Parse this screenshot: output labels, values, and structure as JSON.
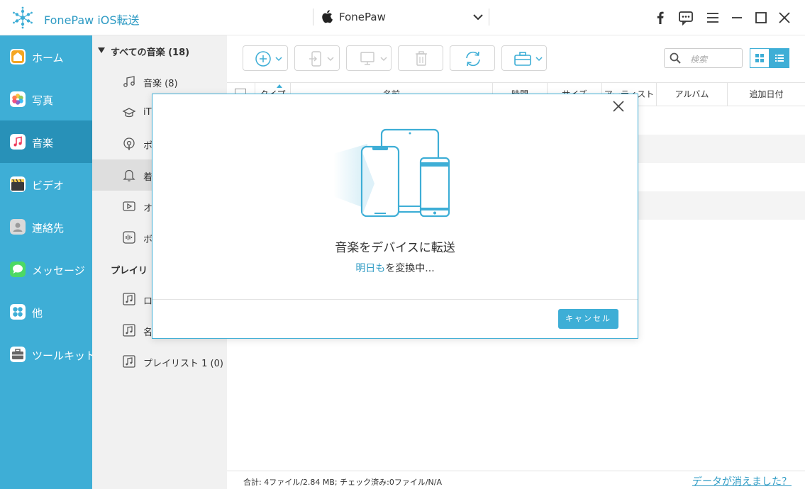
{
  "app": {
    "title": "FonePaw iOS転送"
  },
  "device": {
    "name": "FonePaw"
  },
  "sidebar": {
    "items": [
      {
        "label": "ホーム",
        "icon": "home-icon",
        "color": "#f5a623"
      },
      {
        "label": "写真",
        "icon": "photos-icon",
        "color": "#ffffff"
      },
      {
        "label": "音楽",
        "icon": "music-icon",
        "color": "#ffffff"
      },
      {
        "label": "ビデオ",
        "icon": "video-icon",
        "color": "#3a3a3a"
      },
      {
        "label": "連絡先",
        "icon": "contacts-icon",
        "color": "#9a9a9a"
      },
      {
        "label": "メッセージ",
        "icon": "messages-icon",
        "color": "#4cd964"
      },
      {
        "label": "他",
        "icon": "other-icon",
        "color": "#ffffff"
      },
      {
        "label": "ツールキット",
        "icon": "toolkit-icon",
        "color": "#666666"
      }
    ],
    "active": "音楽"
  },
  "subpanel": {
    "all_music_header": "すべての音楽 (18)",
    "items": [
      {
        "label": "音楽 (8)",
        "icon": "note-icon"
      },
      {
        "label": "iT",
        "icon": "itunes-u-icon"
      },
      {
        "label": "ポ",
        "icon": "podcast-icon"
      },
      {
        "label": "着",
        "icon": "bell-icon"
      },
      {
        "label": "オ",
        "icon": "audiobook-icon"
      },
      {
        "label": "ボ",
        "icon": "voice-memo-icon"
      }
    ],
    "playlist_header": "プレイリ",
    "playlists": [
      {
        "label": "ロ"
      },
      {
        "label": "名"
      },
      {
        "label": "プレイリスト 1 (0)"
      }
    ]
  },
  "toolbar": {
    "search_placeholder": "検索"
  },
  "table": {
    "columns": [
      "タイプ",
      "名前",
      "時間",
      "サイズ",
      "アーティスト",
      "アルバム",
      "追加日付"
    ]
  },
  "status": {
    "summary": "合計: 4ファイル/2.84 MB; チェック済み:0ファイル/N/A",
    "data_link": "データが消えました？"
  },
  "modal": {
    "title": "音楽をデバイスに転送",
    "item_name": "明日も",
    "progress_suffix": "を変換中...",
    "cancel_label": "キャンセル"
  },
  "colors": {
    "accent": "#3eaed6",
    "accent_dark": "#2891b8",
    "link": "#2f9bc4"
  }
}
